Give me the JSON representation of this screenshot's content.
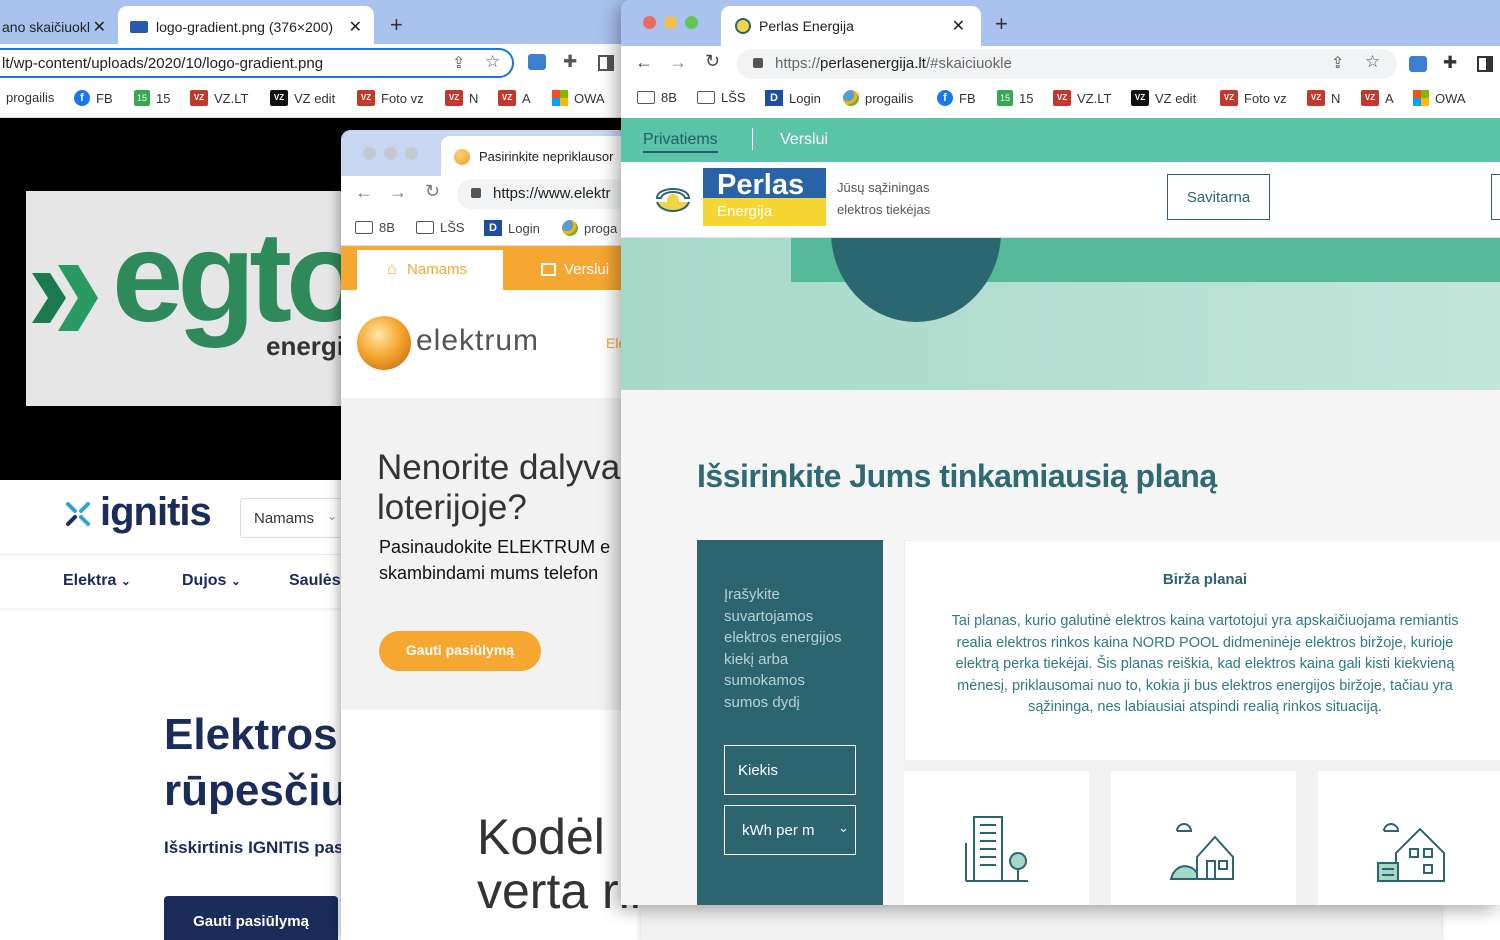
{
  "win1": {
    "tabs": [
      "ano skaičiuokl",
      "logo-gradient.png (376×200)"
    ],
    "url": "lt/wp-content/uploads/2020/10/logo-gradient.png",
    "bookmarks": [
      "progailis",
      "FB",
      "15",
      "VZ.LT",
      "VZ edit",
      "Foto vz",
      "N",
      "A",
      "OWA"
    ],
    "logo_word": "egto",
    "logo_sub": "energi"
  },
  "ignitis": {
    "brand": "ignitis",
    "select_value": "Namams",
    "nav": [
      "Elektra",
      "Dujos",
      "Saulės"
    ],
    "hero_title_1": "Elektros",
    "hero_title_2": "rūpesčiu",
    "hero_sub": "Išskirtinis IGNITIS pas",
    "cta": "Gauti pasiūlymą",
    "colors": {
      "navy": "#1b2b5a",
      "accent": "#2fa3d6"
    }
  },
  "win2": {
    "tab": "Pasirinkite nepriklausor",
    "url": "https://www.elektr",
    "bookmarks": [
      "8B",
      "LŠS",
      "Login",
      "proga"
    ],
    "nav": [
      "Namams",
      "Verslui"
    ],
    "brand": "elektrum",
    "menu_peek": "Ele",
    "headline_1": "Nenorite dalyvau",
    "headline_2": "loterijoje?",
    "sub_1": "Pasinaudokite ELEKTRUM e",
    "sub_2": "skambindami mums telefon",
    "cta": "Gauti pasiūlymą",
    "big_1": "Kodėl",
    "big_2": "verta rinktis „Elektrum“?",
    "colors": {
      "orange": "#f6a731"
    }
  },
  "win3": {
    "tab": "Perlas Energija",
    "url_scheme": "https://",
    "url_host": "perlasenergija.lt",
    "url_path": "/#skaiciuokle",
    "bookmarks": [
      "8B",
      "LŠS",
      "Login",
      "progailis",
      "FB",
      "15",
      "VZ.LT",
      "VZ edit",
      "Foto vz",
      "N",
      "A",
      "OWA"
    ],
    "nav": [
      "Privatiems",
      "Verslui"
    ],
    "logo_top": "Perlas",
    "logo_bottom": "Energija",
    "tagline_1": "Jūsų sąžiningas",
    "tagline_2": "elektros tiekėjas",
    "savitarna": "Savitarna",
    "heading": "Išsirinkite Jums tinkamiausią planą",
    "side_text": [
      "Įrašykite",
      "suvartojamos",
      "elektros energijos",
      "kiekį arba",
      "sumokamos",
      "sumos dydį"
    ],
    "qty_placeholder": "Kiekis",
    "unit_select": "kWh per m",
    "plan_title": "Birža planai",
    "plan_desc": "Tai planas, kurio galutinė elektros kaina vartotojui yra apskaičiuojama remiantis realia elektros rinkos kaina NORD POOL didmeninėje elektros biržoje, kurioje elektrą perka tiekėjai. Šis planas reiškia, kad elektros kaina gali kisti kiekvieną mėnesį, priklausomai nuo to, kokia ji bus elektros energijos biržoje, tačiau yra sąžininga, nes labiausiai atspindi realią rinkos situaciją.",
    "cards": [
      "building-icon",
      "small-house-icon",
      "large-house-icon"
    ],
    "colors": {
      "teal": "#2c6570",
      "mint": "#5bc3a7",
      "heading": "#2d6a72"
    }
  }
}
